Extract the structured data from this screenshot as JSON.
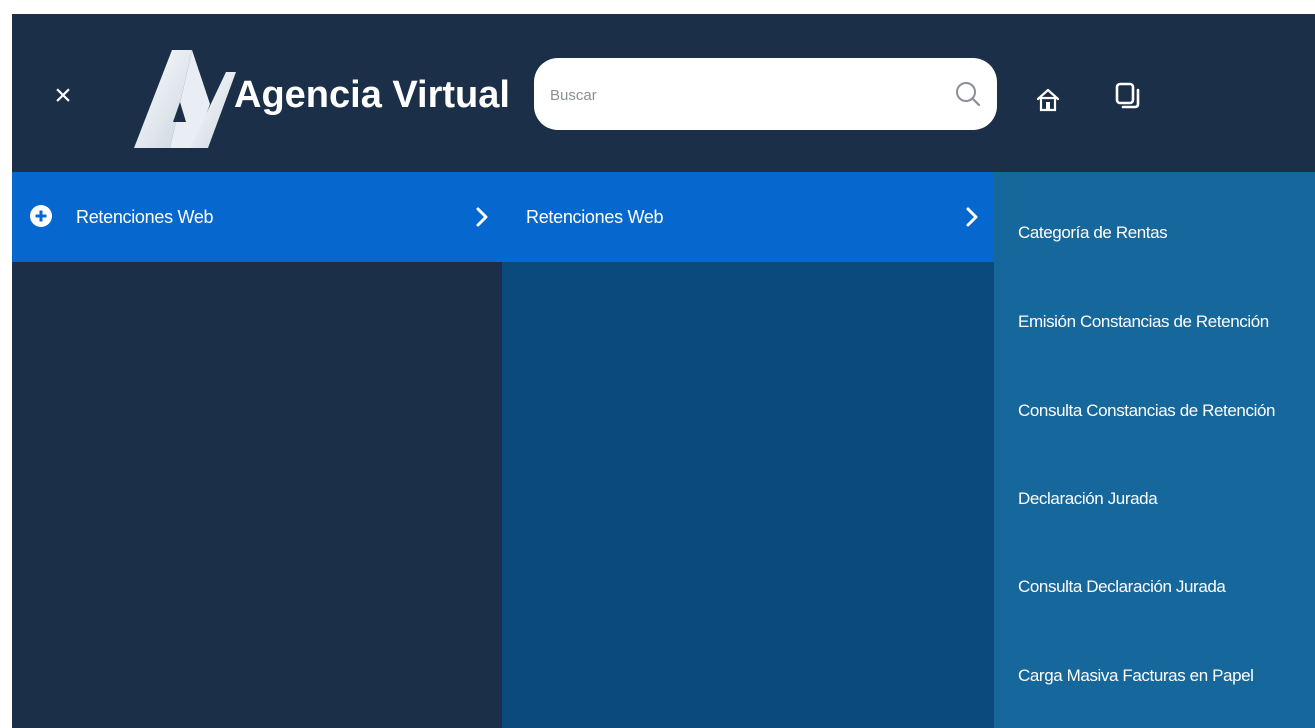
{
  "header": {
    "brand": "Agencia Virtual",
    "logo_alt": "AV",
    "close_glyph": "×",
    "search": {
      "placeholder": "Buscar",
      "value": ""
    },
    "icons": [
      "close-icon",
      "search-icon",
      "home-icon",
      "copy-icon"
    ]
  },
  "menu": {
    "level1": {
      "label": "Retenciones Web"
    },
    "level2": {
      "label": "Retenciones Web"
    },
    "level3": [
      {
        "label": "Categoría de Rentas"
      },
      {
        "label": "Emisión Constancias de Retención"
      },
      {
        "label": "Consulta Constancias de Retención"
      },
      {
        "label": "Declaración Jurada"
      },
      {
        "label": "Consulta Declaración Jurada"
      },
      {
        "label": "Carga Masiva Facturas en Papel"
      }
    ]
  },
  "colors": {
    "header_bg": "#1b2f48",
    "active_item": "#0668ce",
    "column2_bg": "#0b4a7c",
    "column3_bg": "#16679b"
  }
}
